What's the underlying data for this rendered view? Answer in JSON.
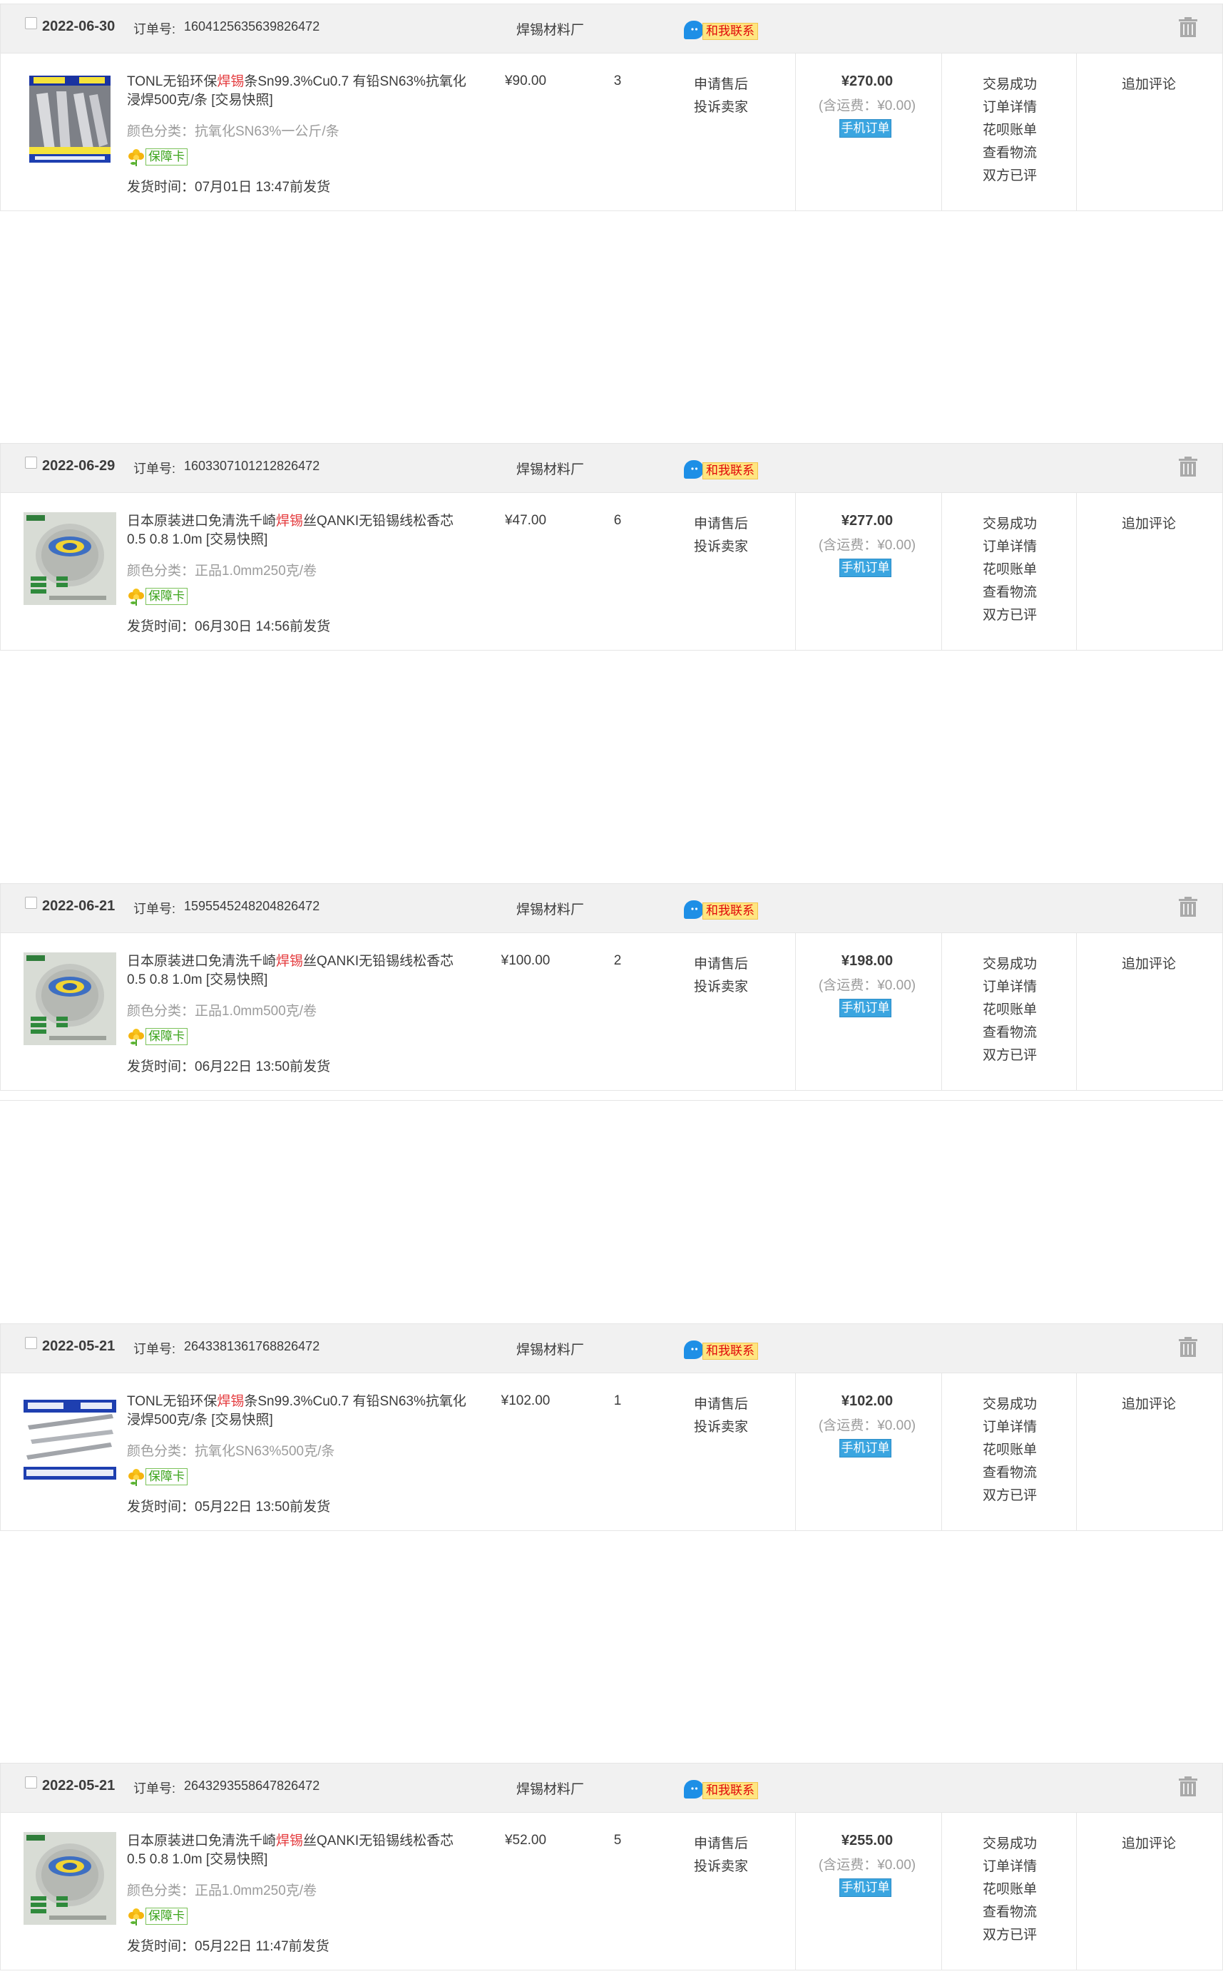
{
  "labels": {
    "order_no": "订单号:",
    "contact": "和我联系",
    "guarantee": "保障卡",
    "after_sale": [
      "申请售后",
      "投诉卖家"
    ],
    "mobile_order": "手机订单",
    "add_review": "追加评论",
    "actions": [
      "交易成功",
      "订单详情",
      "花呗账单",
      "查看物流",
      "双方已评"
    ]
  },
  "colors": {
    "header_bg": "#f1f1f1",
    "border": "#e6e6e6",
    "highlight": "#e4393c",
    "mobile_badge": "#3aa5e0",
    "contact_badge": "#ffe580"
  },
  "orders": [
    {
      "date": "2022-06-30",
      "order_no": "1604125635639826472",
      "shop": "焊锡材料厂",
      "title_pre": "TONL无铅环保",
      "title_hl": "焊锡",
      "title_post": "条Sn99.3%Cu0.7 有铅SN63%抗氧化浸焊500克/条 [交易快照]",
      "spec": "颜色分类：抗氧化SN63%一公斤/条",
      "ship_time": "发货时间：07月01日 13:47前发货",
      "unit_price": "¥90.00",
      "qty": "3",
      "total": "¥270.00",
      "shipping_fee": "(含运费：¥0.00)",
      "thumb": "solder-bar-blue-icon"
    },
    {
      "date": "2022-06-29",
      "order_no": "1603307101212826472",
      "shop": "焊锡材料厂",
      "title_pre": "日本原装进口免清洗千崎",
      "title_hl": "焊锡",
      "title_post": "丝QANKI无铅锡线松香芯 0.5 0.8 1.0m [交易快照]",
      "spec": "颜色分类：正品1.0mm250克/卷",
      "ship_time": "发货时间：06月30日 14:56前发货",
      "unit_price": "¥47.00",
      "qty": "6",
      "total": "¥277.00",
      "shipping_fee": "(含运费：¥0.00)",
      "thumb": "solder-wire-spool-icon"
    },
    {
      "date": "2022-06-21",
      "order_no": "1595545248204826472",
      "shop": "焊锡材料厂",
      "title_pre": "日本原装进口免清洗千崎",
      "title_hl": "焊锡",
      "title_post": "丝QANKI无铅锡线松香芯 0.5 0.8 1.0m [交易快照]",
      "spec": "颜色分类：正品1.0mm500克/卷",
      "ship_time": "发货时间：06月22日 13:50前发货",
      "unit_price": "¥100.00",
      "qty": "2",
      "total": "¥198.00",
      "shipping_fee": "(含运费：¥0.00)",
      "thumb": "solder-wire-spool-icon"
    },
    {
      "date": "2022-05-21",
      "order_no": "2643381361768826472",
      "shop": "焊锡材料厂",
      "title_pre": "TONL无铅环保",
      "title_hl": "焊锡",
      "title_post": "条Sn99.3%Cu0.7 有铅SN63%抗氧化浸焊500克/条 [交易快照]",
      "spec": "颜色分类：抗氧化SN63%500克/条",
      "ship_time": "发货时间：05月22日 13:50前发货",
      "unit_price": "¥102.00",
      "qty": "1",
      "total": "¥102.00",
      "shipping_fee": "(含运费：¥0.00)",
      "thumb": "solder-bar-white-icon"
    },
    {
      "date": "2022-05-21",
      "order_no": "2643293558647826472",
      "shop": "焊锡材料厂",
      "title_pre": "日本原装进口免清洗千崎",
      "title_hl": "焊锡",
      "title_post": "丝QANKI无铅锡线松香芯 0.5 0.8 1.0m [交易快照]",
      "spec": "颜色分类：正品1.0mm250克/卷",
      "ship_time": "发货时间：05月22日 11:47前发货",
      "unit_price": "¥52.00",
      "qty": "5",
      "total": "¥255.00",
      "shipping_fee": "(含运费：¥0.00)",
      "thumb": "solder-wire-spool-icon"
    }
  ]
}
